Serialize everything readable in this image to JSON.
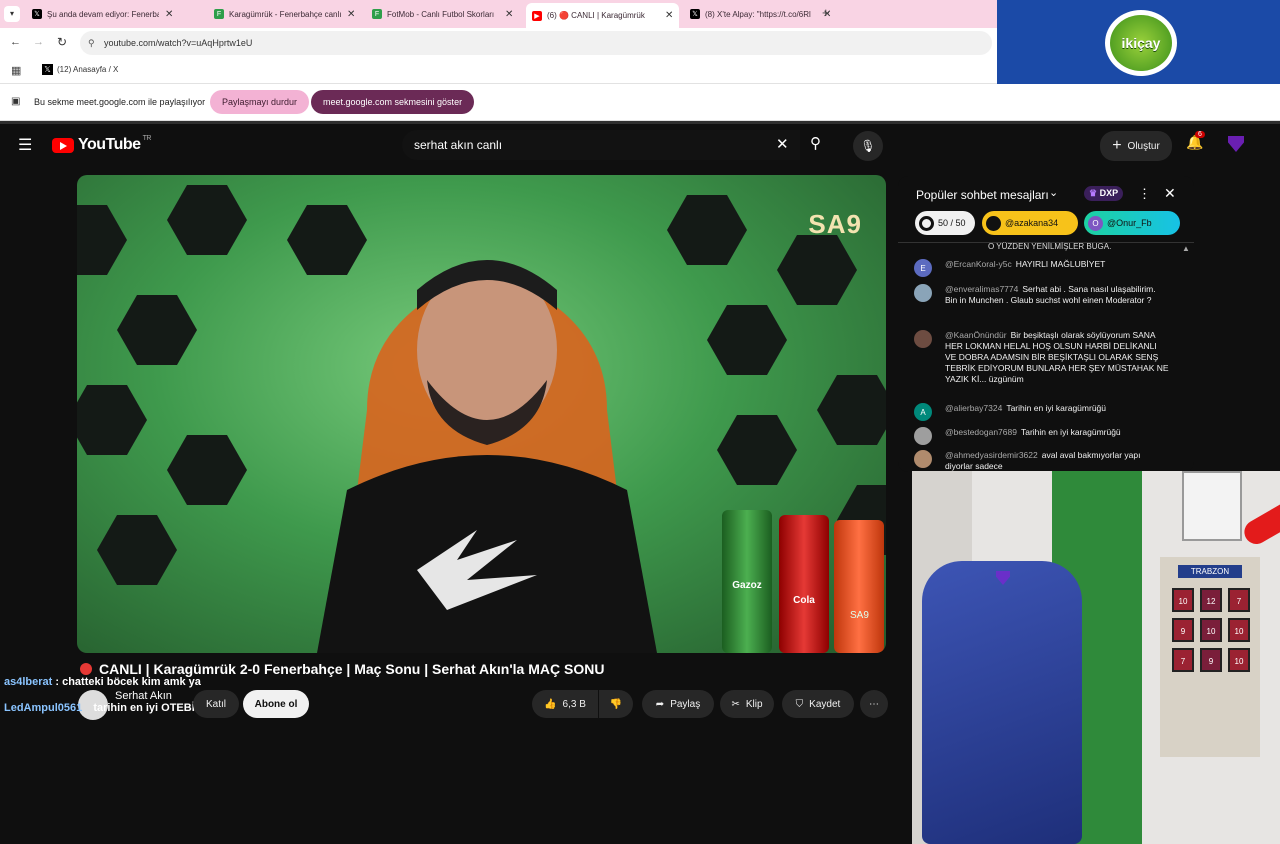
{
  "browser": {
    "tabs": [
      {
        "title": "Şu anda devam ediyor: Fenerbahçe",
        "favicon": "x-logo-icon",
        "active": false
      },
      {
        "title": "Karagümrük - Fenerbahçe canlı",
        "favicon": "fotmob-icon",
        "active": false
      },
      {
        "title": "FotMob - Canlı Futbol Skorları",
        "favicon": "fotmob-icon",
        "active": false
      },
      {
        "title": "(6) 🔴 CANLI | Karagümrük",
        "favicon": "youtube-icon",
        "active": true
      },
      {
        "title": "(8) X'te Alpay: \"https://t.co/6Rl",
        "favicon": "x-logo-icon",
        "active": false
      }
    ],
    "url": "youtube.com/watch?v=uAqHprtw1eU",
    "bookmark": "(12) Anasayfa / X",
    "share_message": "Bu sekme meet.google.com ile paylaşılıyor",
    "stop_sharing": "Paylaşmayı durdur",
    "show_tab": "meet.google.com sekmesini göster"
  },
  "sponsor": {
    "logo_text": "ikiçay"
  },
  "youtube": {
    "logo": "YouTube",
    "region": "TR",
    "search_value": "serhat akın canlı",
    "create": "Oluştur",
    "notif_count": "6",
    "video": {
      "watermark": "SA9",
      "watermark_small": "SA9",
      "can_labels": [
        "Gazoz",
        "Cola"
      ],
      "title": "CANLI | Karagümrük 2-0 Fenerbahçe | Maç Sonu | Serhat Akın'la MAÇ SONU",
      "channel_line1": "Serhat Akın",
      "channel_line2": "",
      "join": "Katıl",
      "subscribe": "Abone ol",
      "likes": "6,3 B",
      "share": "Paylaş",
      "clip": "Klip",
      "save": "Kaydet"
    },
    "chat": {
      "header": "Popüler sohbet mesajları",
      "points": "DXP",
      "progress": "50 / 50",
      "chips": [
        "@azakana34",
        "@Onur_Fb"
      ],
      "partial_top": "O YÜZDEN YENİLMİŞLER BUGA.",
      "messages": [
        {
          "author": "@ErcanKoral-y5c",
          "text": "HAYIRLI MAĞLUBİYET",
          "avatar": "E",
          "color": "#5c6bc0"
        },
        {
          "author": "@enveralimas7774",
          "text": "Serhat abi . Sana nasıl ulaşabilirim. Bin in Munchen . Glaub suchst wohl einen Moderator ?",
          "avatar": "",
          "color": "#8aa4b8"
        },
        {
          "author": "@KaanÖnündür",
          "text": "Bir beşiktaşlı olarak söylüyorum SANA HER LOKMAN HELAL HOŞ OLSUN HARBİ DELİKANLI VE DOBRA ADAMSIN BİR BEŞİKTAŞLI OLARAK SENŞ TEBRİK EDİYORUM BUNLARA HER ŞEY MÜSTAHAK NE YAZIK Kİ... üzgünüm",
          "avatar": "",
          "color": "#6d4c41"
        },
        {
          "author": "@alierbay7324",
          "text": "Tarihin en iyi karagümrüğü",
          "avatar": "A",
          "color": "#00897b"
        },
        {
          "author": "@bestedogan7689",
          "text": "Tarihin en iyi karagümrüğü",
          "avatar": "",
          "color": "#9e9e9e"
        },
        {
          "author": "@ahmedyasirdemir3622",
          "text": "aval aval bakmıyorlar yapı diyorlar sadece",
          "avatar": "",
          "color": "#b08b6d"
        }
      ]
    },
    "overlay": {
      "line1_user": "as4lberat",
      "line1_text": ": chatteki böcek kim amk ya",
      "line2_user": "LedAmpul0561",
      "line2_text": "tarihin en iyi OTEBİSİ"
    },
    "cam": {
      "board_title": "TRABZON",
      "shirt_numbers": [
        "10",
        "12",
        "7",
        "9",
        "10",
        "10",
        "7",
        "9",
        "10"
      ]
    }
  }
}
